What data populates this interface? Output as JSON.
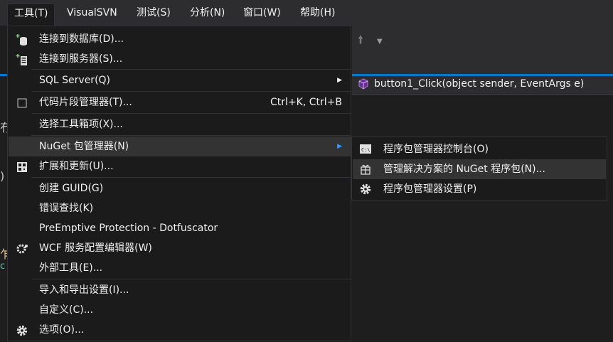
{
  "menubar": {
    "items": [
      {
        "label": "工具(T)"
      },
      {
        "label": "VisualSVN"
      },
      {
        "label": "测试(S)"
      },
      {
        "label": "分析(N)"
      },
      {
        "label": "窗口(W)"
      },
      {
        "label": "帮助(H)"
      }
    ]
  },
  "background": {
    "nav_method": "button1_Click(object sender, EventArgs e)"
  },
  "tools_menu": {
    "items": [
      {
        "label": "连接到数据库(D)..."
      },
      {
        "label": "连接到服务器(S)..."
      },
      {
        "label": "SQL Server(Q)"
      },
      {
        "label": "代码片段管理器(T)...",
        "shortcut": "Ctrl+K, Ctrl+B"
      },
      {
        "label": "选择工具箱项(X)..."
      },
      {
        "label": "NuGet 包管理器(N)"
      },
      {
        "label": "扩展和更新(U)..."
      },
      {
        "label": "创建 GUID(G)"
      },
      {
        "label": "错误查找(K)"
      },
      {
        "label": "PreEmptive Protection - Dotfuscator"
      },
      {
        "label": "WCF 服务配置编辑器(W)"
      },
      {
        "label": "外部工具(E)..."
      },
      {
        "label": "导入和导出设置(I)..."
      },
      {
        "label": "自定义(C)..."
      },
      {
        "label": "选项(O)..."
      }
    ]
  },
  "nuget_submenu": {
    "items": [
      {
        "label": "程序包管理器控制台(O)",
        "icon_text": "C:\\"
      },
      {
        "label": "管理解决方案的 NuGet 程序包(N)..."
      },
      {
        "label": "程序包管理器设置(P)"
      }
    ]
  },
  "colors": {
    "menu_bg": "#1b1b1c",
    "hover_bg": "#333334",
    "accent": "#007acc",
    "text": "#f1f1f1"
  }
}
